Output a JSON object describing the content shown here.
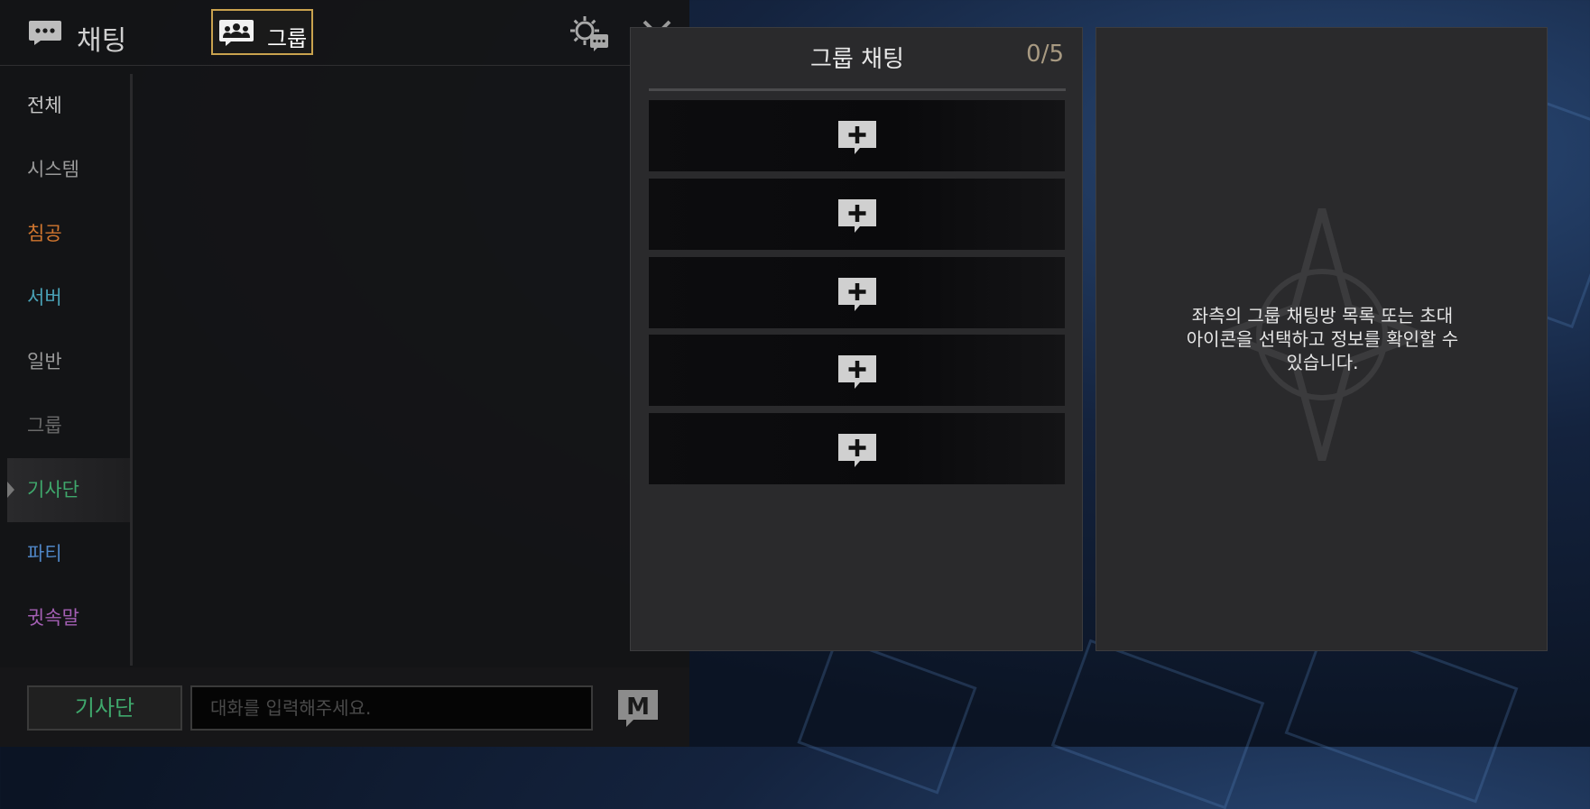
{
  "chat": {
    "title": "채팅",
    "group_tab_label": "그룹",
    "sidebar": [
      {
        "label": "전체",
        "color": "#c8c8c8"
      },
      {
        "label": "시스템",
        "color": "#9a9a9a"
      },
      {
        "label": "침공",
        "color": "#d0762f"
      },
      {
        "label": "서버",
        "color": "#4aa3b8"
      },
      {
        "label": "일반",
        "color": "#9a9a9a"
      },
      {
        "label": "그룹",
        "color": "#6a6a6a"
      },
      {
        "label": "기사단",
        "color": "#3fa86c"
      },
      {
        "label": "파티",
        "color": "#4f86c6"
      },
      {
        "label": "귓속말",
        "color": "#a45fb4"
      }
    ],
    "active_channel": "기사단",
    "channel_button": "기사단",
    "input_placeholder": "대화를 입력해주세요.",
    "macro_icon": "M"
  },
  "group_chat": {
    "title": "그룹 채팅",
    "count": "0/5",
    "slots": [
      {
        "icon": "add-chat-icon"
      },
      {
        "icon": "add-chat-icon"
      },
      {
        "icon": "add-chat-icon"
      },
      {
        "icon": "add-chat-icon"
      },
      {
        "icon": "add-chat-icon"
      }
    ]
  },
  "info": {
    "message": "좌측의 그룹 채팅방 목록 또는 초대\n아이콘을 선택하고 정보를 확인할 수\n있습니다."
  }
}
